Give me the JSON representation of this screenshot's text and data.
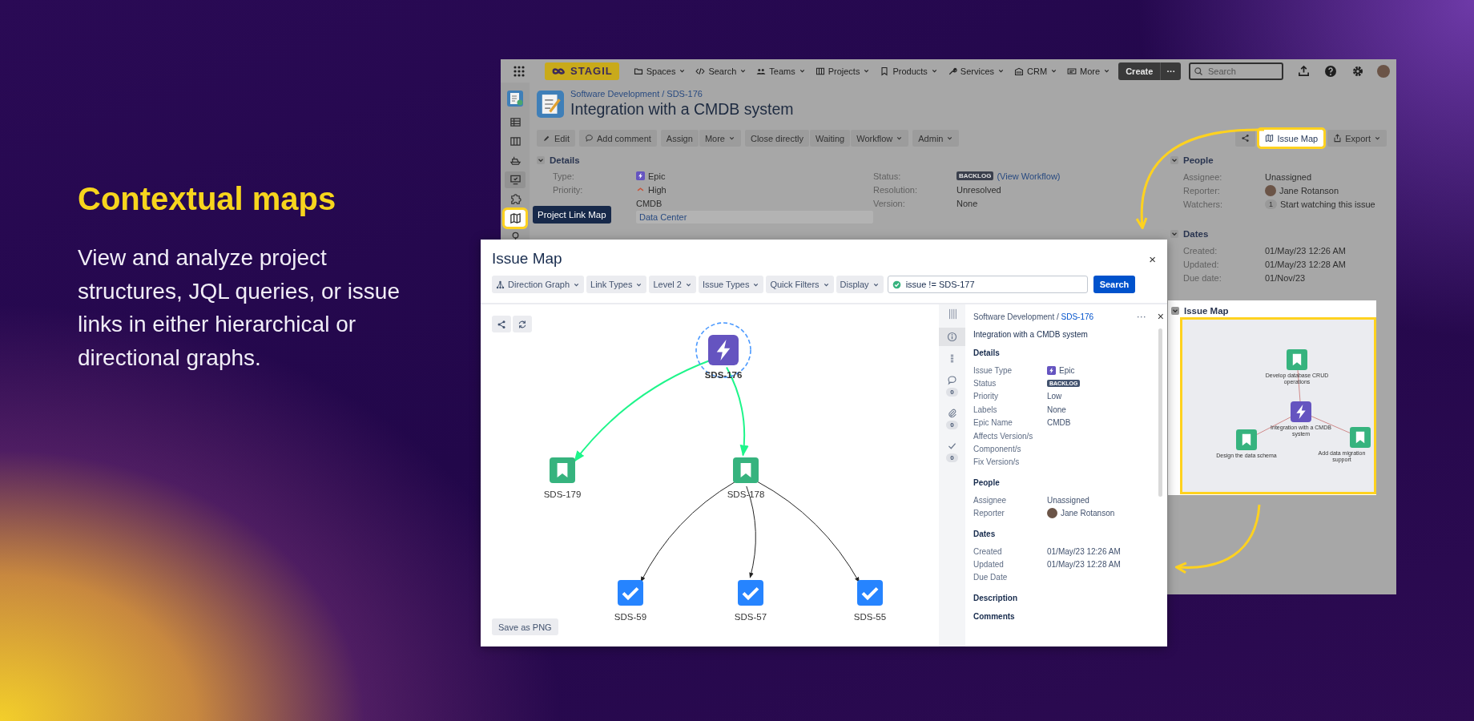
{
  "promo": {
    "heading": "Contextual maps",
    "text": "View and analyze project structures, JQL queries, or issue links in either hierarchical or directional graphs."
  },
  "nav": {
    "logo": "STAGIL",
    "menus": [
      {
        "label": "Spaces",
        "kind": "folder"
      },
      {
        "label": "Search",
        "kind": "code"
      },
      {
        "label": "Teams",
        "kind": "people"
      },
      {
        "label": "Projects",
        "kind": "board"
      },
      {
        "label": "Products",
        "kind": "bookmark"
      },
      {
        "label": "Services",
        "kind": "wrench"
      },
      {
        "label": "CRM",
        "kind": "building"
      },
      {
        "label": "More",
        "kind": "card"
      }
    ],
    "create": "Create",
    "create_more": "···",
    "search": {
      "placeholder": "Search"
    }
  },
  "sidebar": {
    "items": [
      {
        "kind": "project",
        "selected": false,
        "highlighted": false
      },
      {
        "kind": "backlog",
        "selected": false,
        "highlighted": false
      },
      {
        "kind": "columns",
        "selected": false,
        "highlighted": false
      },
      {
        "kind": "ship",
        "selected": false,
        "highlighted": false
      },
      {
        "kind": "monitor",
        "selected": true,
        "highlighted": false
      },
      {
        "kind": "puzzle",
        "selected": false,
        "highlighted": false
      },
      {
        "kind": "map",
        "selected": false,
        "highlighted": true
      },
      {
        "kind": "tree",
        "selected": false,
        "highlighted": false
      }
    ],
    "tooltip": "Project Link Map"
  },
  "issue": {
    "project": "Software Development",
    "separator": "/",
    "key": "SDS-176",
    "title": "Integration with a CMDB system",
    "action_groups": [
      {
        "actions": [
          {
            "label": "Edit",
            "kind": "edit",
            "dropdown": false,
            "highlighted": false
          }
        ]
      },
      {
        "actions": [
          {
            "label": "Add comment",
            "kind": "comment",
            "dropdown": false,
            "highlighted": false
          }
        ]
      },
      {
        "actions": [
          {
            "label": "Assign",
            "kind": "plain",
            "dropdown": false,
            "highlighted": false
          },
          {
            "label": "More",
            "kind": "plain",
            "dropdown": true,
            "highlighted": false
          }
        ]
      },
      {
        "actions": [
          {
            "label": "Close directly",
            "kind": "plain",
            "dropdown": false,
            "highlighted": false
          },
          {
            "label": "Waiting",
            "kind": "plain",
            "dropdown": false,
            "highlighted": false
          },
          {
            "label": "Workflow",
            "kind": "plain",
            "dropdown": true,
            "highlighted": false
          }
        ]
      },
      {
        "actions": [
          {
            "label": "Admin",
            "kind": "plain",
            "dropdown": true,
            "highlighted": false
          }
        ]
      }
    ],
    "tool_groups": [
      {
        "actions": [
          {
            "kind": "share",
            "dropdown": false,
            "highlighted": false
          }
        ]
      },
      {
        "actions": [
          {
            "label": "Issue Map",
            "kind": "map",
            "dropdown": false,
            "highlighted": true
          }
        ]
      },
      {
        "actions": [
          {
            "label": "Export",
            "kind": "export",
            "dropdown": true,
            "highlighted": false
          }
        ]
      }
    ],
    "details": {
      "title": "Details",
      "left": [
        {
          "label": "Type:",
          "value": "Epic",
          "kind": "epic"
        },
        {
          "label": "Priority:",
          "value": "High",
          "kind": "priority"
        },
        {
          "value": "CMDB",
          "kind": "text"
        },
        {
          "value": "Data Center",
          "kind": "tag"
        }
      ],
      "right": [
        {
          "label": "Status:",
          "value": "BACKLOG",
          "link": "(View Workflow)",
          "kind": "status"
        },
        {
          "label": "Resolution:",
          "value": "Unresolved",
          "kind": "text"
        },
        {
          "label": "Version:",
          "value": "None",
          "kind": "text"
        }
      ]
    },
    "people": {
      "title": "People",
      "rows": [
        {
          "label": "Assignee:",
          "value": "Unassigned",
          "kind": "text"
        },
        {
          "label": "Reporter:",
          "value": "Jane Rotanson",
          "kind": "user"
        },
        {
          "label": "Watchers:",
          "count": "1",
          "value": "Start watching this issue",
          "kind": "watch"
        }
      ]
    },
    "dates": {
      "title": "Dates",
      "rows": [
        {
          "label": "Created:",
          "value": "01/May/23 12:26 AM",
          "kind": "text"
        },
        {
          "label": "Updated:",
          "value": "01/May/23 12:28 AM",
          "kind": "text"
        },
        {
          "label": "Due date:",
          "value": "01/Nov/23",
          "kind": "text"
        }
      ]
    },
    "map_panel": {
      "title": "Issue Map",
      "highlighted": true,
      "tree": {
        "label": "Integration with a CMDB system",
        "kind": "epic",
        "children": [
          {
            "label": "Develop database CRUD operations",
            "kind": "story"
          },
          {
            "label": "Design the data schema",
            "kind": "story"
          },
          {
            "label": "Add data migration support",
            "kind": "story"
          }
        ]
      }
    }
  },
  "modal": {
    "title": "Issue Map",
    "close": "×",
    "filters": [
      {
        "label": "Direction Graph",
        "kind": "graph"
      },
      {
        "label": "Link Types",
        "kind": "plain"
      },
      {
        "label": "Level 2",
        "kind": "plain"
      },
      {
        "label": "Issue Types",
        "kind": "plain"
      },
      {
        "label": "Quick Filters",
        "kind": "plain"
      },
      {
        "label": "Display",
        "kind": "plain"
      }
    ],
    "query": {
      "value": "issue != SDS-177",
      "valid": true
    },
    "search": "Search",
    "canvas_tools": [
      {
        "kind": "share"
      },
      {
        "kind": "refresh"
      }
    ],
    "graph": {
      "tree": {
        "key": "SDS-176",
        "kind": "epic",
        "focused": true,
        "children": [
          {
            "key": "SDS-179",
            "kind": "story",
            "focused": false,
            "color": "#1ef58a"
          },
          {
            "key": "SDS-178",
            "kind": "story",
            "focused": false,
            "color": "#1ef58a",
            "children": [
              {
                "key": "SDS-59",
                "kind": "task",
                "focused": false,
                "color": "#222222"
              },
              {
                "key": "SDS-57",
                "kind": "task",
                "focused": false,
                "color": "#222222"
              },
              {
                "key": "SDS-55",
                "kind": "task",
                "focused": false,
                "color": "#222222"
              }
            ]
          }
        ]
      }
    },
    "save": "Save as PNG",
    "rail": {
      "tabs": [
        {
          "kind": "info",
          "selected": true
        },
        {
          "kind": "list",
          "selected": false
        },
        {
          "kind": "comment",
          "count": "0",
          "selected": false
        },
        {
          "kind": "attachment",
          "count": "0",
          "selected": false
        },
        {
          "kind": "check",
          "count": "0",
          "selected": false
        }
      ]
    },
    "panel": {
      "project": "Software Development",
      "separator": "/",
      "key": "SDS-176",
      "menu": "···",
      "close": "×",
      "summary": "Integration with a CMDB system",
      "sections": [
        {
          "title": "Details",
          "rows": [
            {
              "label": "Issue Type",
              "value": "Epic",
              "kind": "epic"
            },
            {
              "label": "Status",
              "value": "BACKLOG",
              "kind": "status"
            },
            {
              "label": "Priority",
              "value": "Low",
              "kind": "text"
            },
            {
              "label": "Labels",
              "value": "None",
              "kind": "text"
            },
            {
              "label": "Epic Name",
              "value": "CMDB",
              "kind": "text"
            },
            {
              "label": "Affects Version/s",
              "kind": "empty"
            },
            {
              "label": "Component/s",
              "kind": "empty"
            },
            {
              "label": "Fix Version/s",
              "kind": "empty"
            }
          ]
        },
        {
          "title": "People",
          "rows": [
            {
              "label": "Assignee",
              "value": "Unassigned",
              "kind": "text"
            },
            {
              "label": "Reporter",
              "value": "Jane Rotanson",
              "kind": "user"
            }
          ]
        },
        {
          "title": "Dates",
          "rows": [
            {
              "label": "Created",
              "value": "01/May/23 12:26 AM",
              "kind": "text"
            },
            {
              "label": "Updated",
              "value": "01/May/23 12:28 AM",
              "kind": "text"
            },
            {
              "label": "Due Date",
              "kind": "empty"
            }
          ]
        },
        {
          "title": "Description"
        },
        {
          "title": "Comments"
        }
      ]
    }
  }
}
